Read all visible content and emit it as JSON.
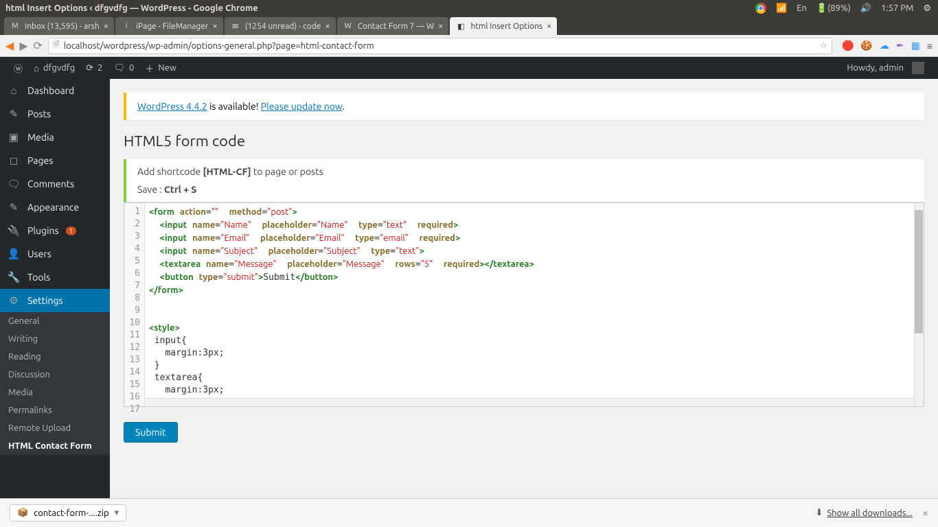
{
  "ubuntu": {
    "window_title": "html Insert Options ‹ dfgvdfg — WordPress - Google Chrome",
    "lang": "En",
    "battery": "(89%)",
    "time": "1:57 PM"
  },
  "tabs": [
    {
      "label": "Inbox (13,595) - arsh",
      "favicon": "M"
    },
    {
      "label": "iPage - FileManager",
      "favicon": "i"
    },
    {
      "label": "(1254 unread) - code",
      "favicon": "✉"
    },
    {
      "label": "Contact Form 7 — W",
      "favicon": "W"
    },
    {
      "label": "html Insert Options",
      "favicon": "◧",
      "active": true
    }
  ],
  "url": "localhost/wordpress/wp-admin/options-general.php?page=html-contact-form",
  "adminbar": {
    "site": "dfgvdfg",
    "updates": "2",
    "comments": "0",
    "new": "New",
    "howdy": "Howdy, admin"
  },
  "sidebar": {
    "items": [
      {
        "icon": "⌂",
        "label": "Dashboard"
      },
      {
        "icon": "✎",
        "label": "Posts"
      },
      {
        "icon": "▣",
        "label": "Media"
      },
      {
        "icon": "◻",
        "label": "Pages"
      },
      {
        "icon": "🗨",
        "label": "Comments"
      },
      {
        "icon": "✎",
        "label": "Appearance"
      },
      {
        "icon": "🔌",
        "label": "Plugins",
        "badge": "1"
      },
      {
        "icon": "👤",
        "label": "Users"
      },
      {
        "icon": "🔧",
        "label": "Tools"
      },
      {
        "icon": "⚙",
        "label": "Settings",
        "active": true
      }
    ],
    "submenu": [
      "General",
      "Writing",
      "Reading",
      "Discussion",
      "Media",
      "Permalinks",
      "Remote Upload",
      "HTML Contact Form"
    ],
    "submenu_current": "HTML Contact Form"
  },
  "content": {
    "update_version": "WordPress 4.4.2",
    "update_mid": " is available! ",
    "update_link": "Please update now",
    "page_title": "HTML5 form code",
    "shortcode_pre": "Add shortcode ",
    "shortcode": "[HTML-CF]",
    "shortcode_post": " to page or posts",
    "save_pre": "Save : ",
    "save_key": "Ctrl + S",
    "submit_label": "Submit"
  },
  "code": {
    "line_count": 17
  },
  "download": {
    "file": "contact-form-....zip",
    "show_all": "Show all downloads..."
  }
}
